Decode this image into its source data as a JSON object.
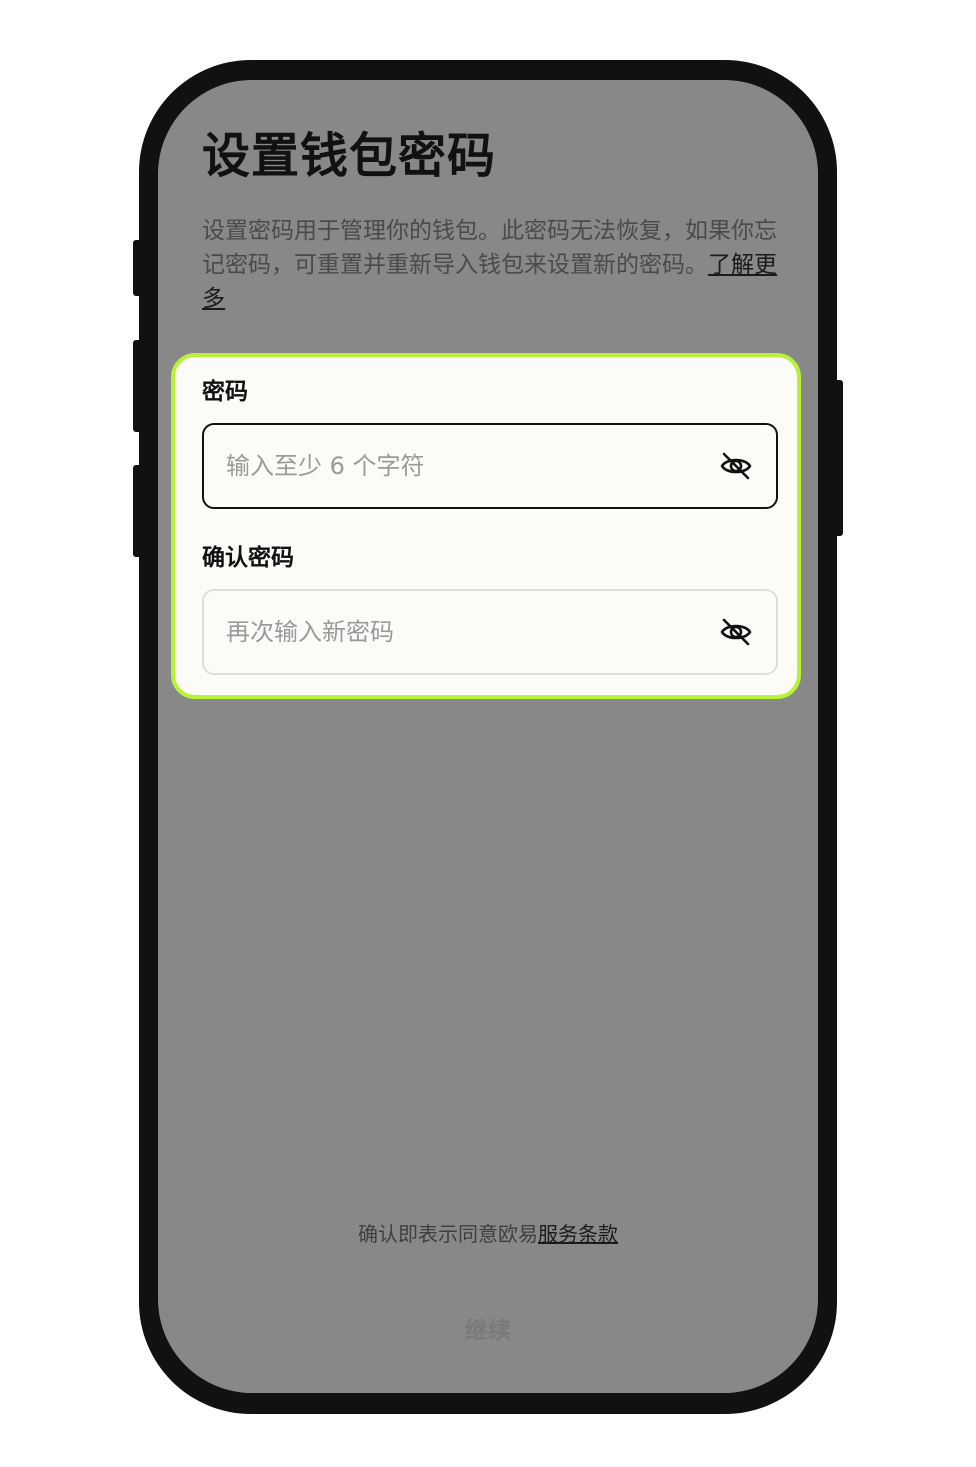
{
  "header": {
    "title": "设置钱包密码",
    "description": "设置密码用于管理你的钱包。此密码无法恢复，如果你忘记密码，可重置并重新导入钱包来设置新的密码。",
    "learn_more": "了解更多"
  },
  "form": {
    "password": {
      "label": "密码",
      "placeholder": "输入至少 6 个字符",
      "value": ""
    },
    "confirm_password": {
      "label": "确认密码",
      "placeholder": "再次输入新密码",
      "value": ""
    }
  },
  "footer": {
    "terms_prefix": "确认即表示同意欧易",
    "terms_link": "服务条款",
    "continue_label": "继续"
  },
  "icons": {
    "password_toggle": "eye-off-icon",
    "confirm_toggle": "eye-off-icon"
  },
  "colors": {
    "accent_border": "#b7f239",
    "overlay": "#888888"
  }
}
